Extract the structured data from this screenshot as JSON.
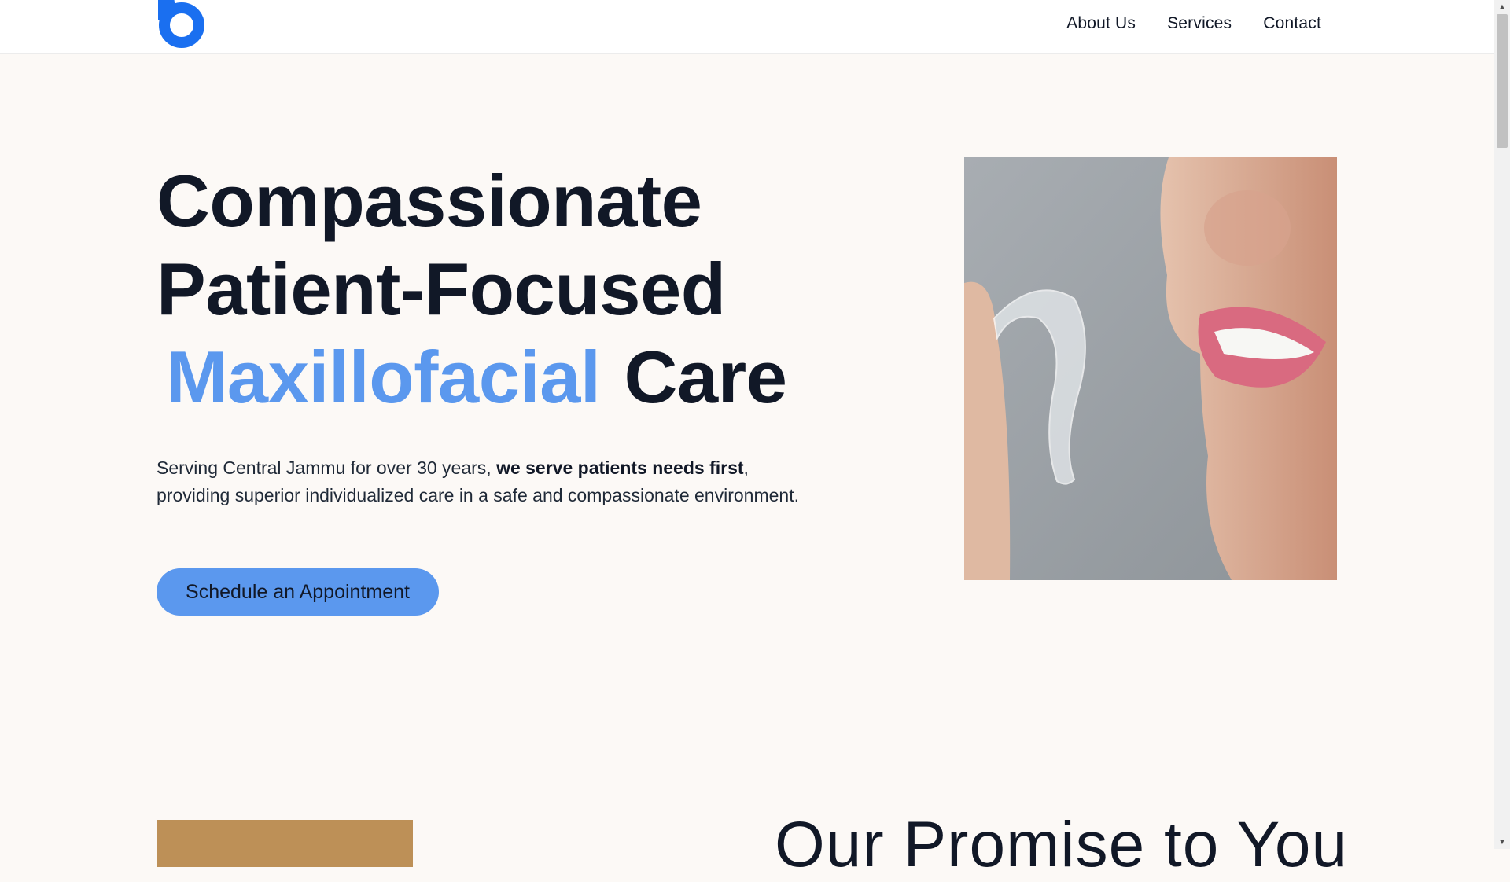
{
  "nav": {
    "items": [
      "About Us",
      "Services",
      "Contact"
    ]
  },
  "hero": {
    "title_line1": "Compassionate",
    "title_line2": "Patient-Focused",
    "title_accent": "Maxillofacial",
    "title_end": "Care",
    "desc_part1": "Serving Central Jammu for over 30 years, ",
    "desc_bold": "we serve patients needs first",
    "desc_part2": ", providing superior individualized care in a safe and compassionate environment.",
    "cta_label": "Schedule an Appointment"
  },
  "promise": {
    "title": "Our Promise to You"
  },
  "colors": {
    "accent": "#5b98ee",
    "logo": "#1a6ff0",
    "background": "#fcf9f6",
    "block": "#bd9057"
  },
  "icons": {
    "logo": "brand-logo-icon",
    "scroll_up": "scroll-up-icon",
    "scroll_down": "scroll-down-icon"
  }
}
